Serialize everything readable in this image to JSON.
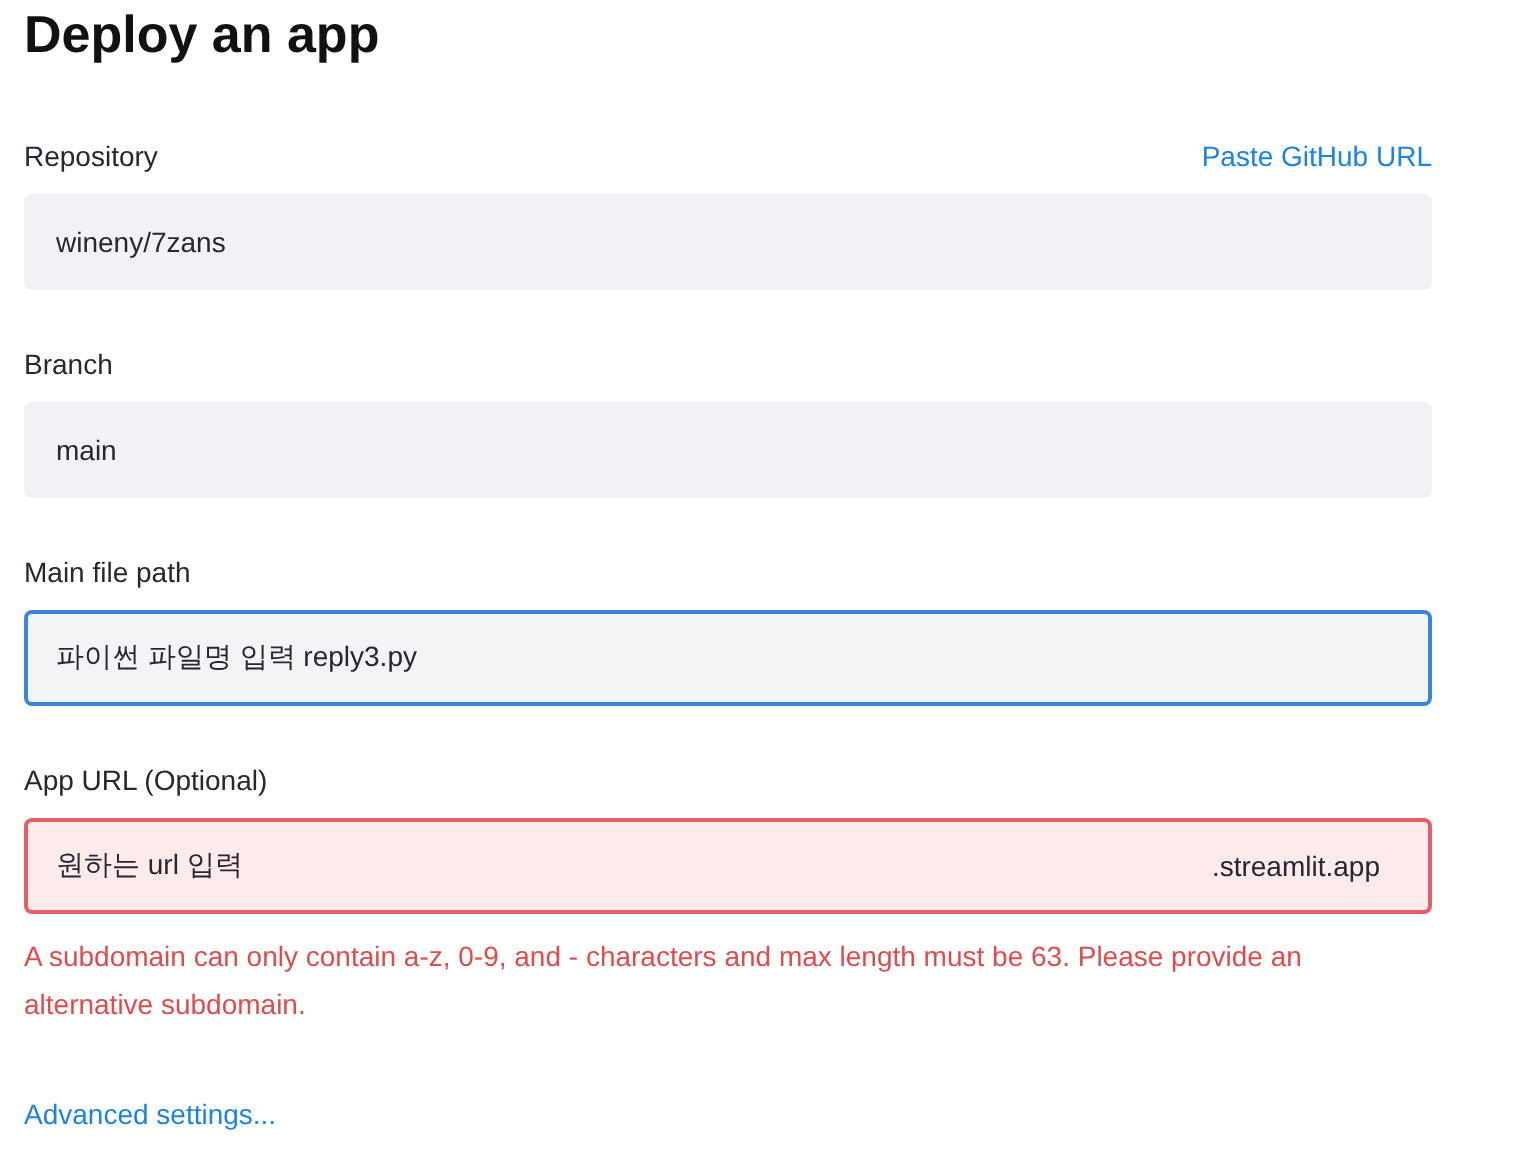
{
  "title": "Deploy an app",
  "fields": [
    {
      "label": "Repository",
      "link": "Paste GitHub URL",
      "value": "wineny/7zans",
      "focused": false,
      "invalid": false
    },
    {
      "label": "Branch",
      "value": "main",
      "focused": false,
      "invalid": false
    },
    {
      "label": "Main file path",
      "value": "파이썬 파일명 입력 reply3.py",
      "focused": true,
      "invalid": false
    },
    {
      "label": "App URL (Optional)",
      "value": "원하는 url 입력",
      "suffix": ".streamlit.app",
      "focused": false,
      "invalid": true,
      "error": "A subdomain can only contain a-z, 0-9, and - characters and max length must be 63. Please provide an alternative subdomain."
    }
  ],
  "advanced_link": "Advanced settings..."
}
